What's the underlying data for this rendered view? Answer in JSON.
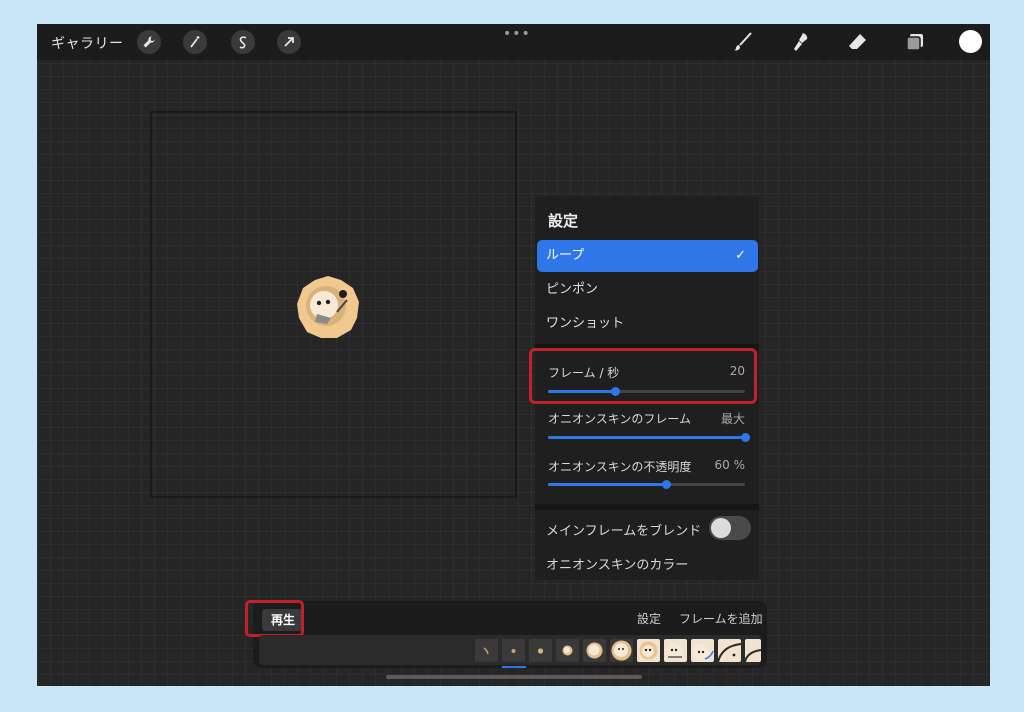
{
  "topbar": {
    "gallery_label": "ギャラリー",
    "menu_dots": "•••",
    "tools_left": [
      "wrench-icon",
      "magic-wand-icon",
      "selection-icon",
      "transform-arrow-icon"
    ],
    "tools_right": [
      "brush-icon",
      "smudge-icon",
      "eraser-icon",
      "layers-icon",
      "color-swatch"
    ],
    "current_color": "#ffffff"
  },
  "settings": {
    "title": "設定",
    "options": [
      {
        "label": "ループ",
        "selected": true
      },
      {
        "label": "ピンポン",
        "selected": false
      },
      {
        "label": "ワンショット",
        "selected": false
      }
    ],
    "check_mark": "✓",
    "frames_per_second": {
      "label": "フレーム / 秒",
      "value": "20",
      "fraction": 0.34
    },
    "onion_skin_frames": {
      "label": "オニオンスキンのフレーム",
      "value": "最大",
      "fraction": 1.0
    },
    "onion_skin_opacity": {
      "label": "オニオンスキンの不透明度",
      "value": "60 %",
      "fraction": 0.6
    },
    "blend_primary": {
      "label": "メインフレームをブレンド",
      "enabled": false
    },
    "onion_skin_color": {
      "label": "オニオンスキンのカラー"
    }
  },
  "timeline": {
    "play_label": "再生",
    "settings_label": "設定",
    "add_frame_label": "フレームを追加",
    "frame_count": 11
  },
  "colors": {
    "accent": "#2f76e8",
    "highlight": "#c0212c"
  }
}
